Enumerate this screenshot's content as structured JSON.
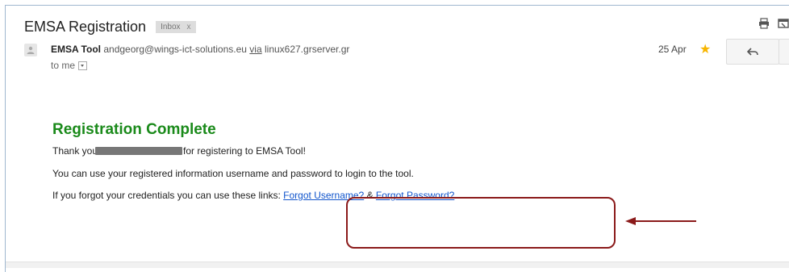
{
  "email": {
    "subject": "EMSA Registration",
    "label": "Inbox",
    "label_remove": "x",
    "sender_name": "EMSA Tool",
    "sender_email": "andgeorg@wings-ict-solutions.eu",
    "via_label": "via",
    "via_server": "linux627.grserver.gr",
    "to_label": "to me",
    "date": "25 Apr"
  },
  "message": {
    "heading": "Registration Complete",
    "line1_before": "Thank you",
    "line1_after": "for registering to EMSA Tool!",
    "line2": "You can use your registered information username and password to login to the tool.",
    "line3_before": "If you forgot your credentials you can use these links:",
    "link_username": "Forgot Username?",
    "amp": "&",
    "link_password": "Forgot Password?"
  },
  "colors": {
    "heading": "#1a8a1a",
    "link": "#1155cc",
    "annotation": "#8b1a1a",
    "star": "#f7b500"
  },
  "icons": [
    "print-icon",
    "new-window-icon",
    "avatar-icon",
    "star-icon",
    "reply-icon",
    "more-options-icon",
    "dropdown-icon",
    "annotation-arrow"
  ]
}
